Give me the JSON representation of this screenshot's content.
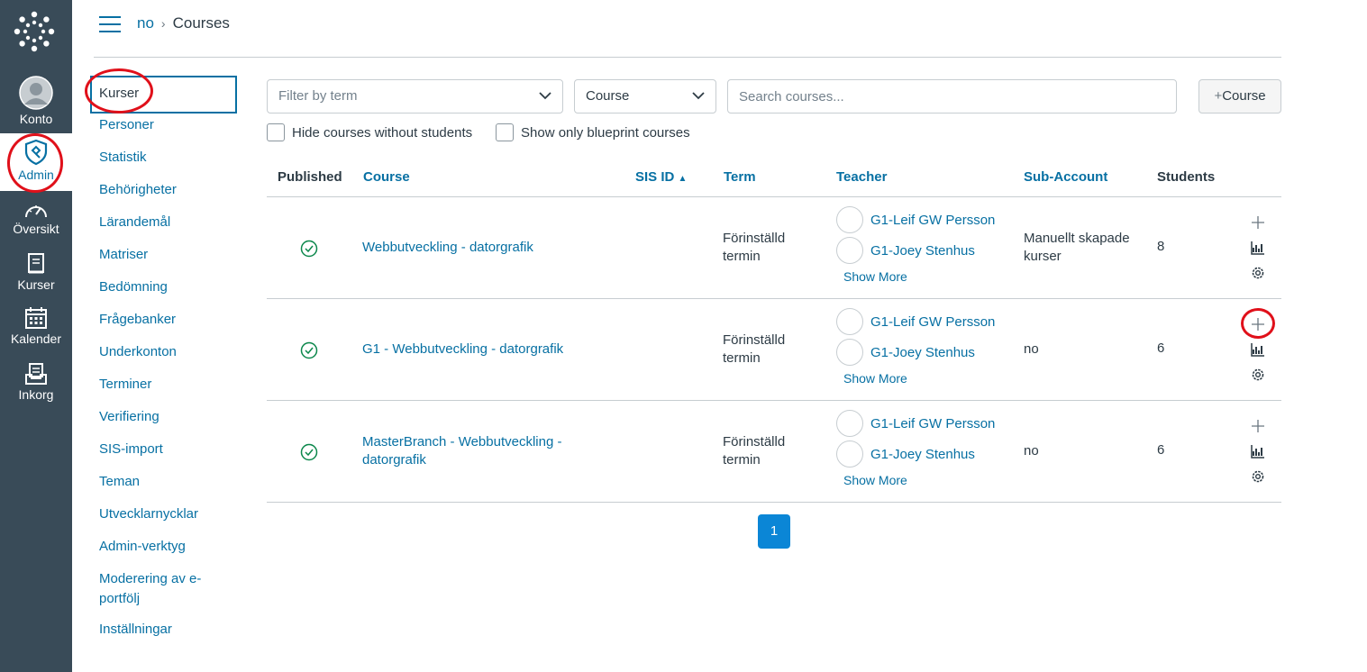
{
  "global_nav": {
    "items": [
      {
        "label": "Konto",
        "icon": "user-avatar-icon"
      },
      {
        "label": "Admin",
        "icon": "shield-icon",
        "active": true
      },
      {
        "label": "Översikt",
        "icon": "dashboard-icon"
      },
      {
        "label": "Kurser",
        "icon": "book-icon"
      },
      {
        "label": "Kalender",
        "icon": "calendar-icon"
      },
      {
        "label": "Inkorg",
        "icon": "inbox-icon"
      }
    ]
  },
  "header": {
    "breadcrumb": [
      "no",
      "Courses"
    ]
  },
  "subnav": {
    "items": [
      "Kurser",
      "Personer",
      "Statistik",
      "Behörigheter",
      "Lärandemål",
      "Matriser",
      "Bedömning",
      "Frågebanker",
      "Underkonton",
      "Terminer",
      "Verifiering",
      "SIS-import",
      "Teman",
      "Utvecklarnycklar",
      "Admin-verktyg",
      "Moderering av e-portfölj",
      "Inställningar"
    ],
    "active": "Kurser"
  },
  "toolbar": {
    "term_placeholder": "Filter by term",
    "type_select": "Course",
    "search_placeholder": "Search courses...",
    "add_button": "Course",
    "hide_without_students": "Hide courses without students",
    "only_blueprint": "Show only blueprint courses"
  },
  "table": {
    "columns": {
      "published": "Published",
      "course": "Course",
      "sis_id": "SIS ID",
      "term": "Term",
      "teacher": "Teacher",
      "sub_account": "Sub-Account",
      "students": "Students"
    },
    "rows": [
      {
        "course": "Webbutveckling - datorgrafik",
        "term": "Förinställd termin",
        "teachers": [
          "G1-Leif GW Persson",
          "G1-Joey Stenhus"
        ],
        "show_more": "Show More",
        "sub_account": "Manuellt skapade kurser",
        "students": "8"
      },
      {
        "course": "G1 - Webbutveckling - datorgrafik",
        "term": "Förinställd termin",
        "teachers": [
          "G1-Leif GW Persson",
          "G1-Joey Stenhus"
        ],
        "show_more": "Show More",
        "sub_account": "no",
        "students": "6"
      },
      {
        "course": "MasterBranch - Webbutveckling - datorgrafik",
        "term": "Förinställd termin",
        "teachers": [
          "G1-Leif GW Persson",
          "G1-Joey Stenhus"
        ],
        "show_more": "Show More",
        "sub_account": "no",
        "students": "6"
      }
    ]
  },
  "pagination": {
    "current": "1"
  },
  "colors": {
    "accent": "#0770a3",
    "nav_bg": "#394b58",
    "published": "#0b874b",
    "highlight": "#e0101a"
  }
}
